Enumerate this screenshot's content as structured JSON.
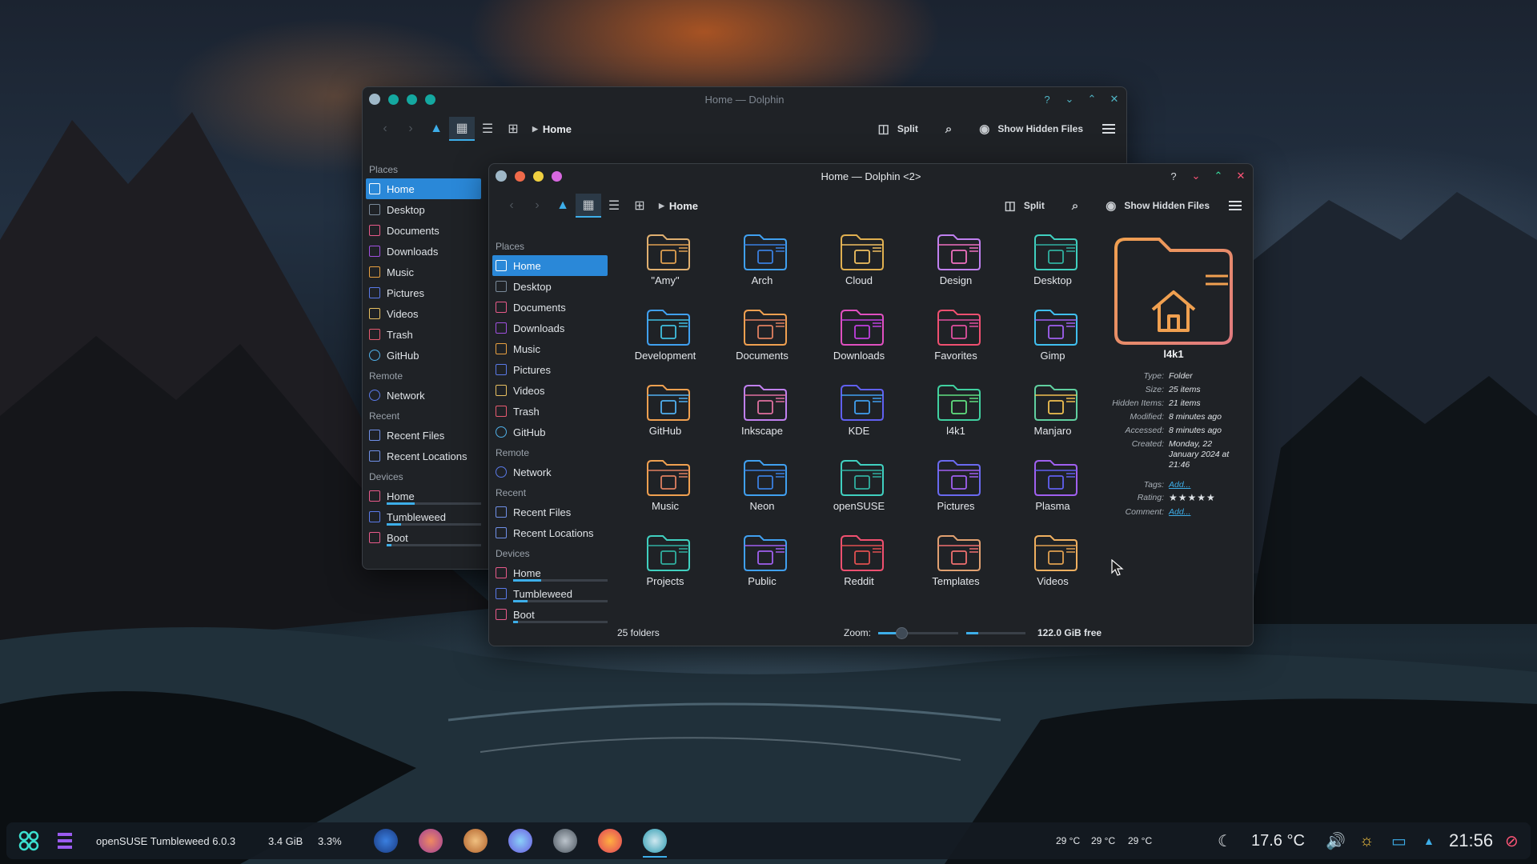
{
  "back_window": {
    "title": "Home — Dolphin",
    "breadcrumb": "Home",
    "toolbar": {
      "split": "Split",
      "hidden": "Show Hidden Files"
    },
    "places_header": "Places",
    "places": [
      "Home",
      "Desktop",
      "Documents",
      "Downloads",
      "Music",
      "Pictures",
      "Videos",
      "Trash",
      "GitHub"
    ],
    "remote_header": "Remote",
    "remote": [
      "Network"
    ],
    "recent_header": "Recent",
    "recent": [
      "Recent Files",
      "Recent Locations"
    ],
    "devices_header": "Devices",
    "devices": [
      "Home",
      "Tumbleweed",
      "Boot"
    ]
  },
  "front_window": {
    "title": "Home — Dolphin <2>",
    "breadcrumb": "Home",
    "toolbar": {
      "split": "Split",
      "hidden": "Show Hidden Files"
    },
    "places_header": "Places",
    "places": [
      "Home",
      "Desktop",
      "Documents",
      "Downloads",
      "Music",
      "Pictures",
      "Videos",
      "Trash",
      "GitHub"
    ],
    "remote_header": "Remote",
    "remote": [
      "Network"
    ],
    "recent_header": "Recent",
    "recent": [
      "Recent Files",
      "Recent Locations"
    ],
    "devices_header": "Devices",
    "devices": [
      "Home",
      "Tumbleweed",
      "Boot"
    ],
    "folders": [
      "\"Amy\"",
      "Arch",
      "Cloud",
      "Design",
      "Desktop",
      "Development",
      "Documents",
      "Downloads",
      "Favorites",
      "Gimp",
      "GitHub",
      "Inkscape",
      "KDE",
      "l4k1",
      "Manjaro",
      "Music",
      "Neon",
      "openSUSE",
      "Pictures",
      "Plasma",
      "Projects",
      "Public",
      "Reddit",
      "Templates",
      "Videos"
    ],
    "info": {
      "name": "l4k1",
      "type_k": "Type:",
      "type_v": "Folder",
      "size_k": "Size:",
      "size_v": "25 items",
      "hidden_k": "Hidden Items:",
      "hidden_v": "21 items",
      "mod_k": "Modified:",
      "mod_v": "8 minutes ago",
      "acc_k": "Accessed:",
      "acc_v": "8 minutes ago",
      "cre_k": "Created:",
      "cre_v": "Monday, 22 January 2024 at 21:46",
      "tags_k": "Tags:",
      "tags_v": "Add...",
      "rating_k": "Rating:",
      "rating_v": "★★★★★",
      "comment_k": "Comment:",
      "comment_v": "Add..."
    },
    "status": {
      "count": "25 folders",
      "zoom": "Zoom:",
      "free": "122.0 GiB free"
    }
  },
  "taskbar": {
    "distro": "openSUSE Tumbleweed 6.0.3",
    "mem": "3.4 GiB",
    "cpu": "3.3%",
    "temps": [
      "29 °C",
      "29 °C",
      "29 °C"
    ],
    "weather": "17.6 °C",
    "clock": "21:56"
  },
  "colors": {
    "accent": "#3daee9",
    "selection": "#2a88d8",
    "close": "#ff5577"
  }
}
